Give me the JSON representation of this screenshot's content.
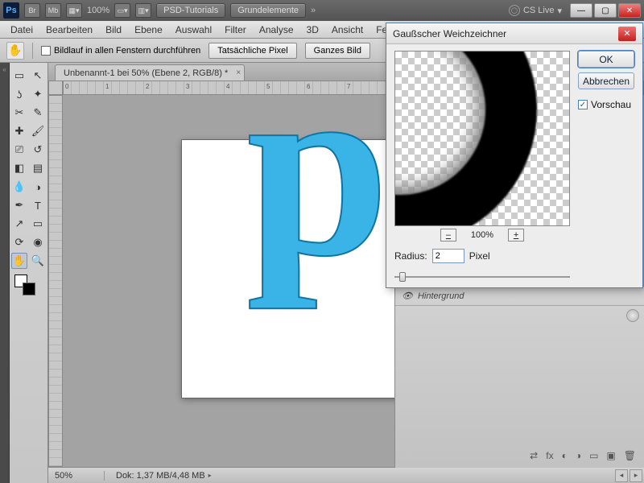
{
  "toolbar": {
    "zoom": "100%",
    "group1": "PSD-Tutorials",
    "group2": "Grundelemente",
    "cslive": "CS Live"
  },
  "menu": [
    "Datei",
    "Bearbeiten",
    "Bild",
    "Ebene",
    "Auswahl",
    "Filter",
    "Analyse",
    "3D",
    "Ansicht",
    "Fe"
  ],
  "options": {
    "scroll_all": "Bildlauf in allen Fenstern durchführen",
    "actual_pixels": "Tatsächliche Pixel",
    "fit_screen": "Ganzes Bild"
  },
  "document": {
    "tab": "Unbenannt-1 bei 50% (Ebene 2, RGB/8) *",
    "status_zoom": "50%",
    "status_doc": "Dok: 1,37 MB/4,48 MB",
    "ruler_marks": [
      "0",
      "1",
      "2",
      "3",
      "4",
      "5",
      "6",
      "7"
    ]
  },
  "layers": {
    "bg_name": "Hintergrund",
    "bottom_icons": [
      "⇄",
      "fx",
      "◐",
      "◑",
      "▭",
      "▣",
      "🗑"
    ]
  },
  "dialog": {
    "title": "Gaußscher Weichzeichner",
    "ok": "OK",
    "cancel": "Abbrechen",
    "preview_label": "Vorschau",
    "zoom_pct": "100%",
    "radius_label": "Radius:",
    "radius_value": "2",
    "radius_unit": "Pixel"
  }
}
